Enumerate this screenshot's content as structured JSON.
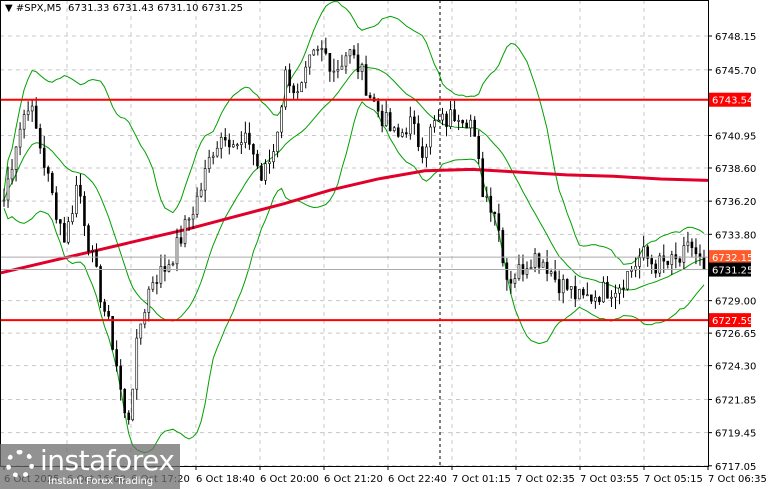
{
  "header": {
    "symbol": "#SPX,M5",
    "open": "6731.33",
    "high": "6731.43",
    "low": "6731.10",
    "close": "6731.25"
  },
  "logo": {
    "name": "instaforex",
    "tagline": "Instant Forex Trading"
  },
  "chart_data": {
    "type": "candlestick",
    "symbol": "#SPX",
    "timeframe": "M5",
    "ylim": [
      6717.05,
      6750.5
    ],
    "y_ticks": [
      "6748.15",
      "6745.70",
      "6740.95",
      "6738.60",
      "6736.20",
      "6733.80",
      "6729.00",
      "6726.65",
      "6724.30",
      "6721.85",
      "6719.45",
      "6717.05"
    ],
    "x_ticks": [
      "6 Oct 2025",
      "6 Oct 16:00",
      "6 Oct 17:20",
      "6 Oct 18:40",
      "6 Oct 20:00",
      "6 Oct 21:20",
      "6 Oct 22:40",
      "7 Oct 01:15",
      "7 Oct 02:35",
      "7 Oct 03:55",
      "7 Oct 05:15",
      "7 Oct 06:35"
    ],
    "price_path": [
      6736.3,
      6740.6,
      6743.5,
      6740,
      6736.3,
      6733.4,
      6737.7,
      6732.7,
      6729,
      6725.4,
      6719.6,
      6726.9,
      6730.5,
      6731.2,
      6732.7,
      6734.8,
      6737,
      6740,
      6741.3,
      6740,
      6740.6,
      6737.7,
      6740,
      6745.7,
      6743.5,
      6746.4,
      6747.1,
      6745.7,
      6747.1,
      6745.7,
      6743.5,
      6742,
      6740.6,
      6742,
      6740,
      6741.7,
      6742,
      6742.8,
      6742,
      6737,
      6735.6,
      6730.5,
      6731.2,
      6732.3,
      6731.9,
      6730.5,
      6729.8,
      6729,
      6729.4,
      6729.8,
      6730.1,
      6731.2,
      6732.3,
      6731.6,
      6731.6,
      6731.8,
      6733,
      6731.25
    ],
    "moving_average": [
      6731.0,
      6731.8,
      6732.6,
      6733.4,
      6734.2,
      6735.1,
      6736.0,
      6737.0,
      6737.8,
      6738.4,
      6738.5,
      6738.3,
      6738.1,
      6738.0,
      6737.8,
      6737.7
    ],
    "levels": [
      {
        "price": "6743.54",
        "color": "#ff0000"
      },
      {
        "price": "6727.59",
        "color": "#ff0000"
      }
    ],
    "bid": "6731.25",
    "ask": "6732.15",
    "colors": {
      "candle": "#000000",
      "bands": "#00a000",
      "ma": "#e0002a",
      "level": "#ff0000"
    }
  }
}
